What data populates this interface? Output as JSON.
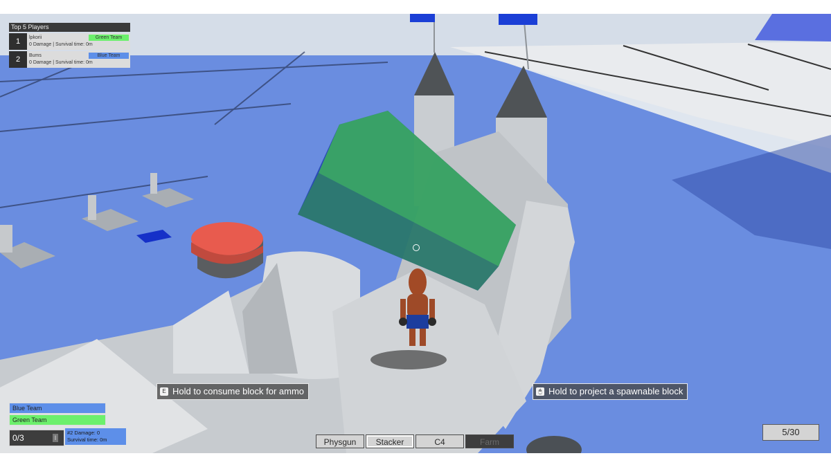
{
  "scoreboard": {
    "title": "Top 5 Players",
    "players": [
      {
        "rank": "1",
        "name": "lpkorii",
        "stats": "0 Damage | Survival time: 0m",
        "team": "Green Team",
        "team_color": "#6cf06c"
      },
      {
        "rank": "2",
        "name": "Bums",
        "stats": "0 Damage | Survival time: 0m",
        "team": "Blue Team",
        "team_color": "#5d8fe9"
      }
    ]
  },
  "prompts": {
    "consume": {
      "key": "E",
      "text": "Hold to consume block for ammo"
    },
    "project": {
      "key": "🖱",
      "text": "Hold to project a spawnable block"
    }
  },
  "teams": {
    "blue": {
      "label": "Blue Team",
      "color": "#5d8fe9"
    },
    "green": {
      "label": "Green Team",
      "color": "#6cf06c"
    }
  },
  "player_status": {
    "count": "0/3",
    "pip": "I",
    "rank_damage": "#2  Damage: 0",
    "survival": "Survival time: 0m"
  },
  "toolbar": {
    "tools": [
      {
        "label": "Physgun",
        "state": "normal"
      },
      {
        "label": "Stacker",
        "state": "selected"
      },
      {
        "label": "C4",
        "state": "normal"
      },
      {
        "label": "Farm",
        "state": "disabled"
      }
    ]
  },
  "ammo": {
    "value": "5/30"
  },
  "colors": {
    "floor_blue": "#6a8de0",
    "tile_white": "#e9ebee",
    "castle_gray": "#c9cdd1",
    "ghost_block": "#3fbd4c",
    "red_button": "#e85b4e"
  }
}
